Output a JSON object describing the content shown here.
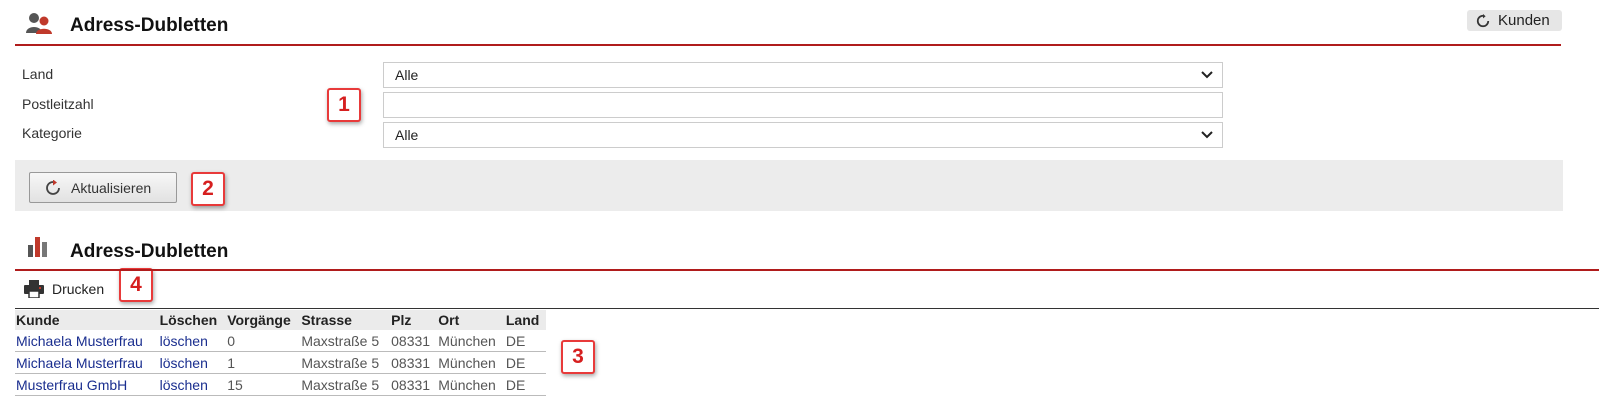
{
  "header": {
    "title": "Adress-Dubletten",
    "icon": "users-icon",
    "kunden_label": "Kunden"
  },
  "form": {
    "land_label": "Land",
    "land_value": "Alle",
    "plz_label": "Postleitzahl",
    "plz_value": "",
    "kategorie_label": "Kategorie",
    "kategorie_value": "Alle",
    "refresh_label": "Aktualisieren"
  },
  "results": {
    "title": "Adress-Dubletten",
    "icon": "bar-chart-icon",
    "print_label": "Drucken",
    "columns": [
      "Kunde",
      "Löschen",
      "Vorgänge",
      "Strasse",
      "Plz",
      "Ort",
      "Land"
    ],
    "rows": [
      [
        "Michaela Musterfrau",
        "löschen",
        "0",
        "Maxstraße 5",
        "08331",
        "München",
        "DE"
      ],
      [
        "Michaela Musterfrau",
        "löschen",
        "1",
        "Maxstraße 5",
        "08331",
        "München",
        "DE"
      ],
      [
        "Musterfrau GmbH",
        "löschen",
        "15",
        "Maxstraße 5",
        "08331",
        "München",
        "DE"
      ]
    ]
  },
  "callouts": [
    "1",
    "2",
    "3",
    "4"
  ],
  "colors": {
    "accent_red": "#b01c1c",
    "link_blue": "#1a2e8f",
    "callout_red": "#e83a3a"
  }
}
